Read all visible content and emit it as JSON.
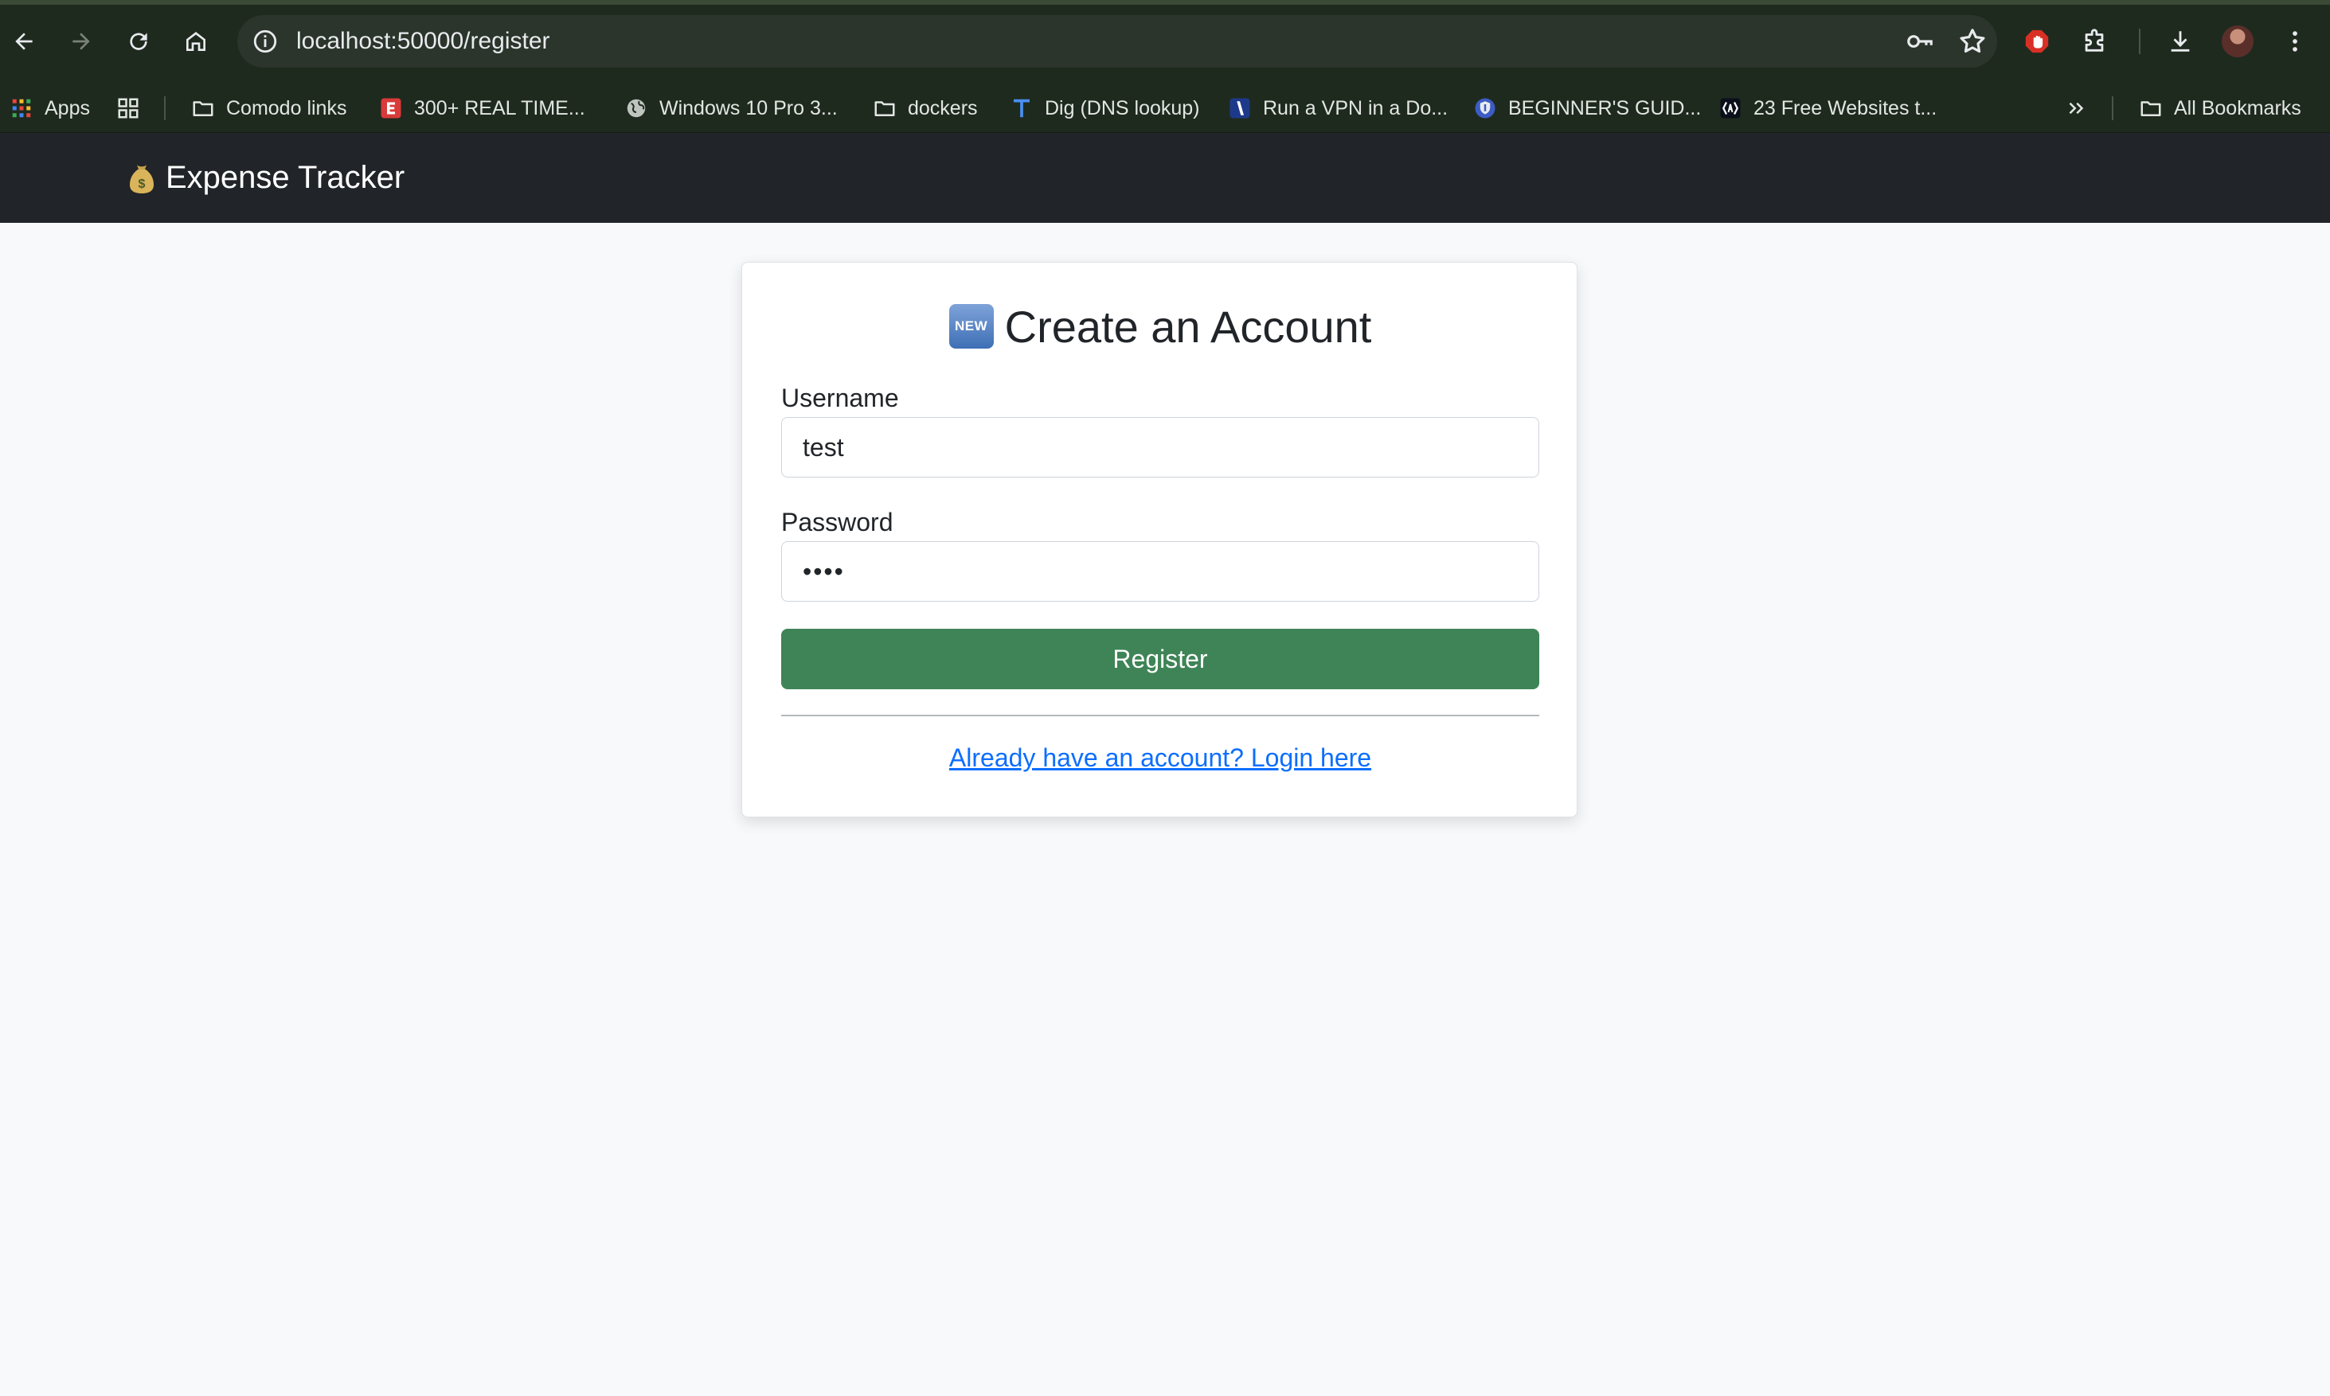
{
  "browser": {
    "url": "localhost:50000/register",
    "bookmarks": [
      {
        "label": "Apps",
        "icon": "apps-grid-icon"
      },
      {
        "label": "",
        "icon": "tab-groups-icon"
      },
      {
        "label": "Comodo links",
        "icon": "folder-icon"
      },
      {
        "label": "300+ REAL TIME...",
        "icon": "e-logo-icon"
      },
      {
        "label": "Windows 10 Pro 3...",
        "icon": "globe-icon"
      },
      {
        "label": "dockers",
        "icon": "folder-icon"
      },
      {
        "label": "Dig (DNS lookup)",
        "icon": "t-logo-icon"
      },
      {
        "label": "Run a VPN in a Do...",
        "icon": "slash-logo-icon"
      },
      {
        "label": "BEGINNER'S GUID...",
        "icon": "shield-logo-icon"
      },
      {
        "label": "23 Free Websites t...",
        "icon": "bracket-logo-icon"
      }
    ],
    "all_bookmarks": "All Bookmarks"
  },
  "app": {
    "brand_emoji": "money-bag-icon",
    "brand": "Expense Tracker"
  },
  "form": {
    "badge": "NEW",
    "title": "Create an Account",
    "username_label": "Username",
    "username_value": "test",
    "password_label": "Password",
    "password_value": "••••",
    "submit_label": "Register",
    "login_link": "Already have an account? Login here"
  },
  "colors": {
    "navbar": "#212529",
    "register_button": "#3f8457",
    "link": "#0d6efd",
    "page_background": "#f8f9fa"
  }
}
